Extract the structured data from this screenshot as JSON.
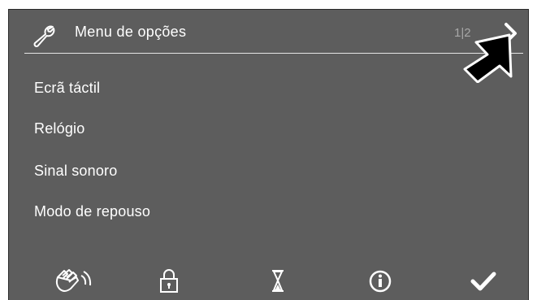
{
  "header": {
    "title": "Menu de opções",
    "page_indicator": "1|2"
  },
  "menu": {
    "items": [
      {
        "label": "Ecrã táctil"
      },
      {
        "label": "Relógio"
      },
      {
        "label": "Sinal sonoro"
      },
      {
        "label": "Modo de repouso"
      }
    ]
  },
  "footer": {
    "icons": [
      "hand-wave-icon",
      "lock-icon",
      "hourglass-icon",
      "info-icon",
      "checkmark-icon"
    ]
  },
  "colors": {
    "screen_background": "#5d5d5d",
    "text": "#ffffff",
    "page_indicator": "#a8a8a8"
  }
}
